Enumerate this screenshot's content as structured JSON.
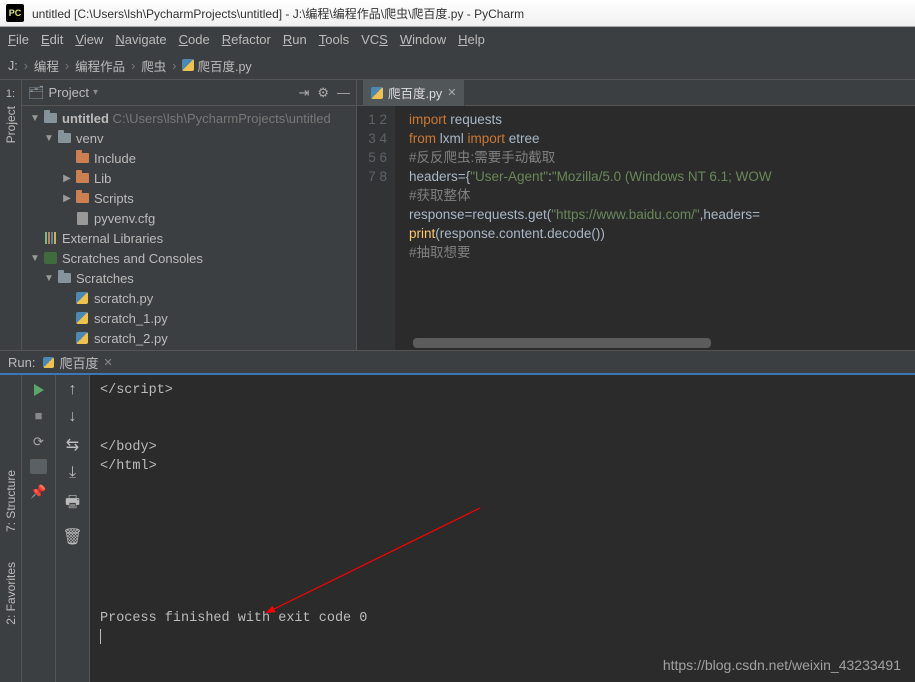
{
  "titlebar": {
    "title": "untitled [C:\\Users\\lsh\\PycharmProjects\\untitled] - J:\\编程\\编程作品\\爬虫\\爬百度.py - PyCharm"
  },
  "menubar": {
    "items": [
      {
        "hot": "F",
        "rest": "ile"
      },
      {
        "hot": "E",
        "rest": "dit"
      },
      {
        "hot": "V",
        "rest": "iew"
      },
      {
        "hot": "N",
        "rest": "avigate"
      },
      {
        "hot": "C",
        "rest": "ode"
      },
      {
        "hot": "R",
        "rest": "efactor"
      },
      {
        "hot": "R",
        "rest": "un",
        "pre": ""
      },
      {
        "hot": "T",
        "rest": "ools"
      },
      {
        "pre": "VC",
        "hot": "S",
        "rest": ""
      },
      {
        "hot": "W",
        "rest": "indow"
      },
      {
        "hot": "H",
        "rest": "elp"
      }
    ]
  },
  "breadcrumb": {
    "items": [
      "J:",
      "编程",
      "编程作品",
      "爬虫",
      "爬百度.py"
    ]
  },
  "project_panel": {
    "header": "Project",
    "tree": [
      {
        "depth": 0,
        "arrow": "▼",
        "icon": "folder-i",
        "label": "untitled",
        "suffix": " C:\\Users\\lsh\\PycharmProjects\\untitled",
        "bold": true
      },
      {
        "depth": 1,
        "arrow": "▼",
        "icon": "folder-i",
        "label": "venv"
      },
      {
        "depth": 2,
        "arrow": "",
        "icon": "folder-o",
        "label": "Include"
      },
      {
        "depth": 2,
        "arrow": "▶",
        "icon": "folder-o",
        "label": "Lib"
      },
      {
        "depth": 2,
        "arrow": "▶",
        "icon": "folder-o",
        "label": "Scripts"
      },
      {
        "depth": 2,
        "arrow": "",
        "icon": "file-i",
        "label": "pyvenv.cfg"
      },
      {
        "depth": 0,
        "arrow": "",
        "icon": "lib-i",
        "label": "External Libraries"
      },
      {
        "depth": 0,
        "arrow": "▼",
        "icon": "scratch-i",
        "label": "Scratches and Consoles"
      },
      {
        "depth": 1,
        "arrow": "▼",
        "icon": "folder-i",
        "label": "Scratches"
      },
      {
        "depth": 2,
        "arrow": "",
        "icon": "py-file-i",
        "label": "scratch.py"
      },
      {
        "depth": 2,
        "arrow": "",
        "icon": "py-file-i",
        "label": "scratch_1.py"
      },
      {
        "depth": 2,
        "arrow": "",
        "icon": "py-file-i",
        "label": "scratch_2.py"
      }
    ]
  },
  "editor": {
    "tab_label": "爬百度.py",
    "lines": [
      {
        "n": "1",
        "html": "<span class='kw'>import</span> requests"
      },
      {
        "n": "2",
        "html": "<span class='kw'>from</span> lxml <span class='kw'>import</span> etree"
      },
      {
        "n": "3",
        "html": "<span class='com'>#反反爬虫:需要手动截取</span>"
      },
      {
        "n": "4",
        "html": "headers={<span class='str'>\"User-Agent\"</span>:<span class='str'>\"Mozilla/5.0 (Windows NT 6.1; WOW</span>"
      },
      {
        "n": "5",
        "html": "<span class='com'>#获取整体</span>"
      },
      {
        "n": "6",
        "html": "response=requests.get(<span class='str'>\"https://www.baidu.com/\"</span>,headers="
      },
      {
        "n": "7",
        "html": "<span class='fn'>print</span>(response.content.decode())"
      },
      {
        "n": "8",
        "html": "<span class='com'>#抽取想要</span>"
      }
    ]
  },
  "run_panel": {
    "header_label": "Run:",
    "tab_label": "爬百度",
    "output_lines": [
      "</script​>",
      "",
      "",
      "</body>",
      "</html>",
      "",
      "",
      "",
      "",
      "",
      "",
      "",
      "Process finished with exit code 0"
    ]
  },
  "side_tabs": {
    "project_num": "1:",
    "project_label": "Project",
    "structure_num": "7:",
    "structure_label": "Structure",
    "favorites_num": "2:",
    "favorites_label": "Favorites"
  },
  "watermark": "https://blog.csdn.net/weixin_43233491"
}
